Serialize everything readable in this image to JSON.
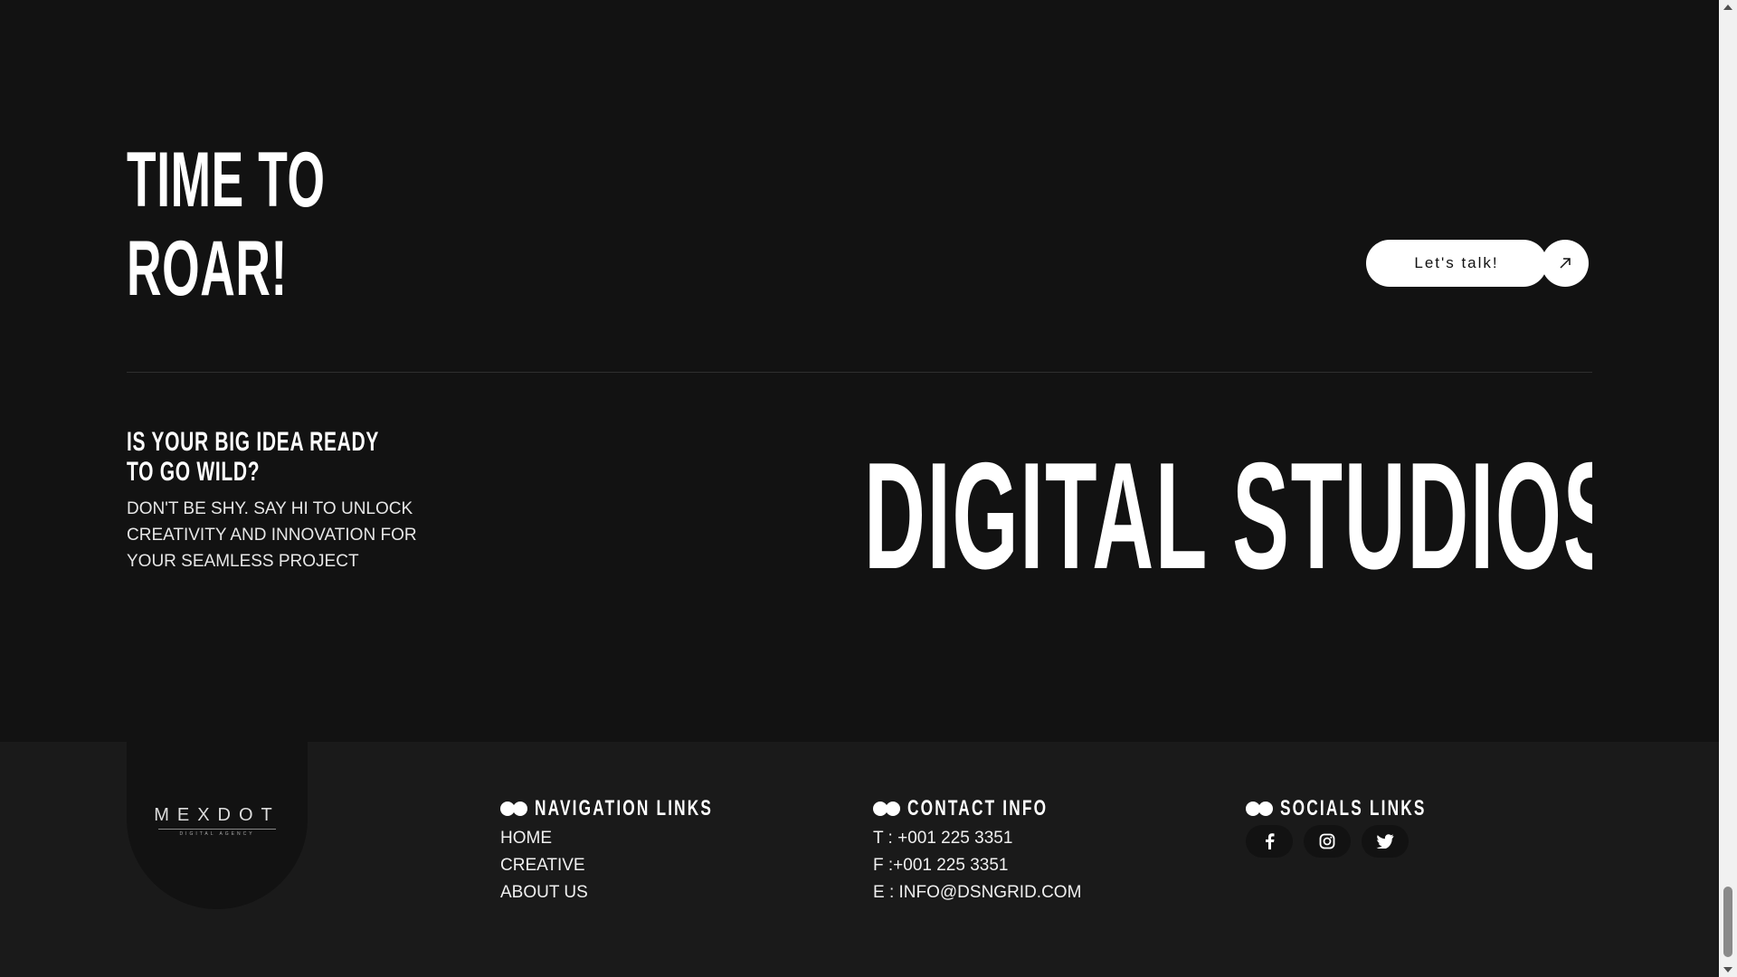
{
  "hero": {
    "line1": "TIME TO",
    "line2": "ROAR!"
  },
  "cta": {
    "label": "Let's talk!",
    "icon": "arrow-up-right-icon"
  },
  "idea": {
    "title_line1": "IS YOUR BIG IDEA READY",
    "title_line2": "TO GO WILD?",
    "text": "DON'T BE SHY. SAY HI TO UNLOCK CREATIVITY AND INNOVATION FOR YOUR SEAMLESS PROJECT"
  },
  "marquee": {
    "text": "DIGITAL STUDIOS DIGITAL STUDIOS"
  },
  "footer": {
    "logo": {
      "name": "MEXDOT",
      "sub": "DIGITAL AGENCY"
    },
    "nav": {
      "title": "NAVIGATION LINKS",
      "items": [
        "HOME",
        "CREATIVE",
        "ABOUT US"
      ]
    },
    "contact": {
      "title": "CONTACT INFO",
      "phone": "T : +001 225 3351",
      "fax": "F :+001 225 3351",
      "email": "E : INFO@DSNGRID.COM"
    },
    "socials": {
      "title": "SOCIALS LINKS",
      "icons": [
        "facebook-icon",
        "instagram-icon",
        "twitter-icon"
      ]
    }
  },
  "colors": {
    "background": "#121212",
    "footer": "#1a1a1a",
    "text": "#ffffff"
  }
}
